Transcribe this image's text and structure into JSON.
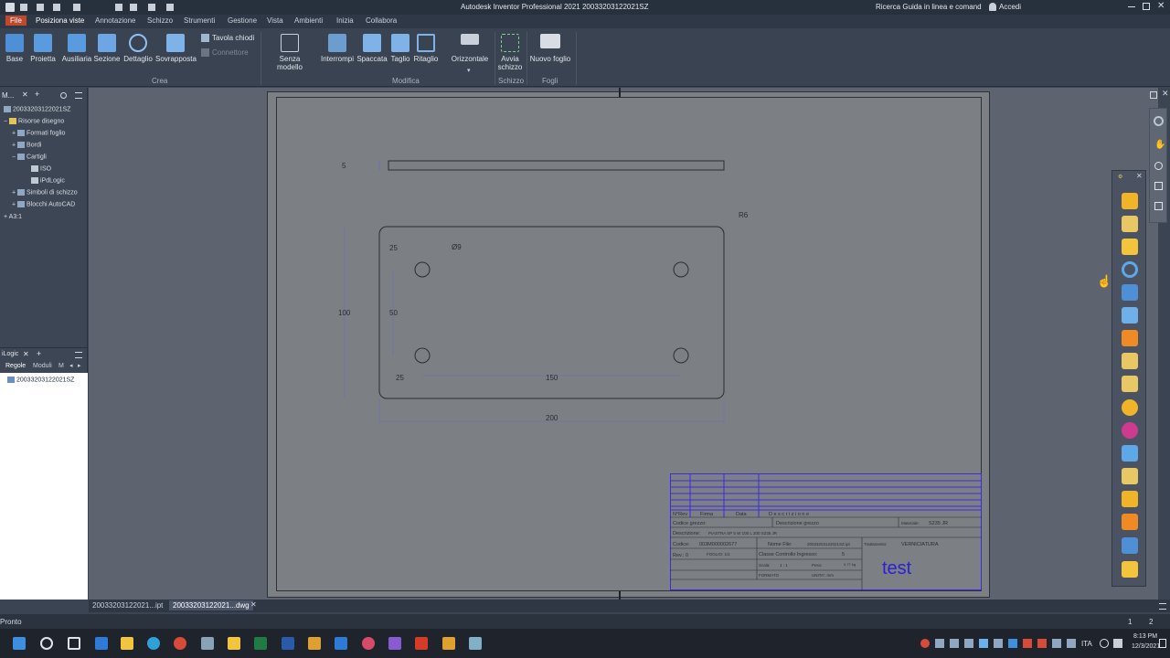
{
  "titlebar": {
    "title": "Autodesk Inventor Professional 2021   20033203122021SZ",
    "search": "Ricerca Guida in linea e comand",
    "signin": "Accedi"
  },
  "ribbon_tabs": [
    "File",
    "Posiziona viste",
    "Annotazione",
    "Schizzo",
    "Strumenti",
    "Gestione",
    "Vista",
    "Ambienti",
    "Inizia",
    "Collabora"
  ],
  "ribbon": {
    "crea": {
      "label": "Crea",
      "buttons": [
        "Base",
        "Proietta",
        "Ausiliaria",
        "Sezione",
        "Dettaglio",
        "Sovrapposta"
      ],
      "small": [
        "Tavola chiodi",
        "Connettore"
      ]
    },
    "modifica": {
      "label": "Modifica",
      "buttons": [
        "Senza modello",
        "Interrompi",
        "Spaccata",
        "Taglio",
        "Ritaglio",
        "Orizzontale"
      ]
    },
    "schizzo": {
      "label": "Schizzo",
      "buttons": [
        "Avvia",
        "schizzo"
      ]
    },
    "fogli": {
      "label": "Fogli",
      "buttons": [
        "Nuovo foglio"
      ]
    }
  },
  "browser": {
    "header": "M...",
    "items": [
      "20033203122021SZ",
      "Risorse disegno",
      "Formati foglio",
      "Bordi",
      "Cartigli",
      "ISO",
      "iPdLogic",
      "Simboli di schizzo",
      "Blocchi AutoCAD",
      "A3:1"
    ]
  },
  "ilogic": {
    "header": "iLogic",
    "tabs": [
      "Regole",
      "Moduli",
      "M"
    ],
    "item": "20033203122021SZ"
  },
  "drawing": {
    "dims": [
      "5",
      "R6",
      "25",
      "Ø9",
      "100",
      "50",
      "25",
      "150",
      "200"
    ],
    "title_block": {
      "cols": [
        "N°Rev",
        "Firma",
        "Data",
        "D e s c r i z i o n e"
      ],
      "codice_grezzo": "Codice grezzo:",
      "descrizione_grezzo": "Descrizione grezzo",
      "materiale": "Materiale:",
      "materiale_val": "S235 JR",
      "descrizione": "Descrizione:",
      "descrizione_val": "PIASTRA SP 5 W 100 L 200 S235 JR",
      "trattamento": "Trattamento:",
      "trattamento_val": "VERNICIATURA",
      "codice": "Codice:",
      "codice_val": "003M000002677",
      "nome_file": "Nome File:",
      "nome_file_val": "20033203122021SZ.ipt",
      "rev": "Rev.: 0",
      "foglio": "FOGLIO: 1/1",
      "classe": "Classe Controllo Ingresso:",
      "classe_val": "5",
      "scala": "Scala:",
      "scala_val": "1 : 1",
      "peso": "Peso:",
      "peso_val": "0.77 kg",
      "formato": "FORMATO",
      "unita": "UNITA': mm",
      "test": "test"
    }
  },
  "doctabs": [
    "20033203122021...ipt",
    "20033203122021...dwg"
  ],
  "status": {
    "text": "Pronto",
    "pages": [
      "1",
      "2"
    ]
  },
  "taskbar": {
    "lang": "ITA",
    "time": "8:13 PM",
    "date": "12/3/2021"
  },
  "colors": {
    "accent": "#c2482c",
    "ribbon": "#3a4352",
    "sheet": "#7c7f84",
    "titleblock": "#3b2ce0"
  }
}
